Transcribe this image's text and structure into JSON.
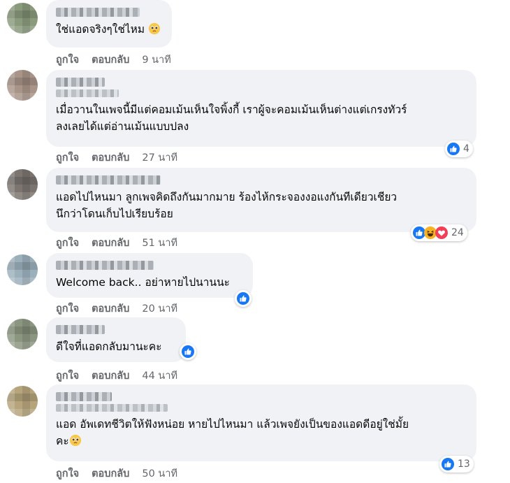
{
  "actions": {
    "like_label": "ถูกใจ",
    "reply_label": "ตอบกลับ"
  },
  "comments": [
    {
      "text": "ใช่แอดจริงๆใช่ไหม",
      "time": "9 นาที",
      "reactions": {
        "count": "",
        "icons": []
      },
      "avatar_color": "#8a9a7c"
    },
    {
      "text": "เมื่อวานในเพจนี้มีแต่คอมเม้นเห็นใจพิ้งกี้ เราผู้จะคอมเม้นเห็นต่างแต่เกรงทัวร์\nลงเลยได้แต่อ่านเม้นแบบปลง",
      "time": "27 นาที",
      "reactions": {
        "count": "4",
        "icons": [
          "like-icon"
        ]
      },
      "avatar_color": "#a89488"
    },
    {
      "text": "แอดไปไหนมา ลูกเพจคิดถึงกันมากมาย ร้องไห้กระจองงอแงกันทีเดียวเชียว\nนึกว่าโดนเก็บไปเรียบร้อย",
      "time": "51 นาที",
      "reactions": {
        "count": "24",
        "icons": [
          "like-icon",
          "haha-icon",
          "love-icon"
        ]
      },
      "avatar_color": "#7b746f"
    },
    {
      "text": "Welcome back.. อย่าหายไปนานนะ",
      "time": "20 นาที",
      "reactions": {
        "count": "",
        "icons": [
          "like-icon"
        ]
      },
      "avatar_color": "#9cb0bc"
    },
    {
      "text": "ดีใจที่แอดกลับมานะคะ",
      "time": "44 นาที",
      "reactions": {
        "count": "",
        "icons": [
          "like-icon"
        ]
      },
      "avatar_color": "#8b9680"
    },
    {
      "text": "แอด อัพเดทชีวิตให้ฟังหน่อย หายไปไหนมา แล้วเพจยังเป็นของแอดดีอยู่ใช่มั้ย\nคะ",
      "time": "50 นาที",
      "reactions": {
        "count": "13",
        "icons": [
          "like-icon"
        ]
      },
      "avatar_color": "#b6a57c"
    }
  ],
  "colors": {
    "bubble_bg": "#f0f2f5",
    "meta_text": "#65676b",
    "like_blue": "#1877f2",
    "love_red": "#f33e58",
    "haha_yellow": "#f7b125"
  }
}
